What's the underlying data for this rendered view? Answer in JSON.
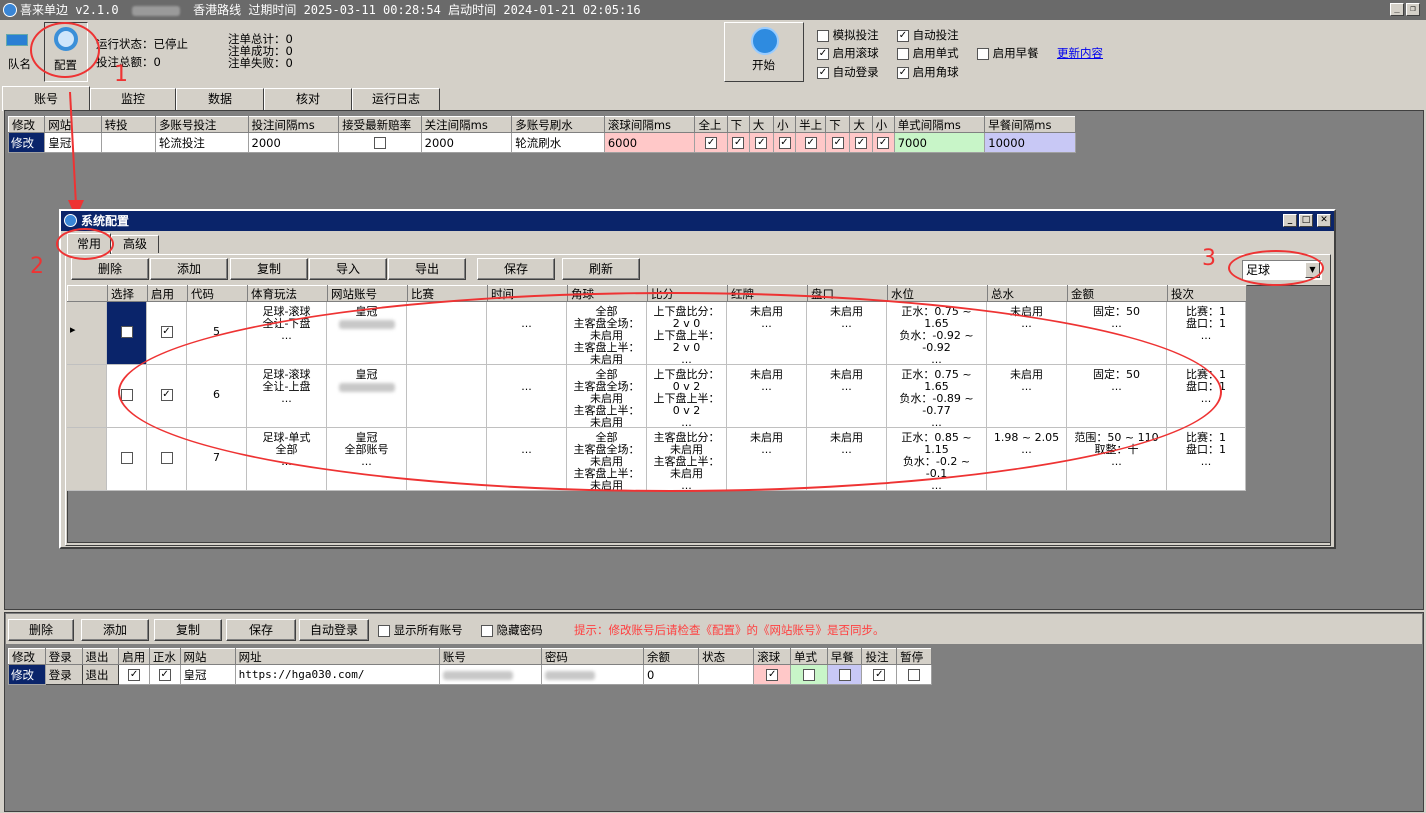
{
  "window": {
    "title_app": "喜来单边",
    "title_version": "v2.1.0",
    "title_route": "香港路线",
    "expire_label": "过期时间",
    "expire_value": "2025-03-11 00:28:54",
    "start_label": "启动时间",
    "start_value": "2024-01-21 02:05:16"
  },
  "toolbar": {
    "queue_label": "队名",
    "config_label": "配置",
    "status_label": "运行状态：已停止",
    "bet_total_label": "投注总额：0",
    "orders_total": "注单总计：0",
    "orders_success": "注单成功：0",
    "orders_fail": "注单失败：0",
    "start_label": "开始",
    "options": [
      {
        "label": "模拟投注",
        "checked": false
      },
      {
        "label": "自动投注",
        "checked": true
      },
      {
        "label": "启用滚球",
        "checked": true
      },
      {
        "label": "启用单式",
        "checked": false
      },
      {
        "label": "启用早餐",
        "checked": false
      },
      {
        "label": "自动登录",
        "checked": true
      },
      {
        "label": "启用角球",
        "checked": true
      }
    ],
    "update_link": "更新内容"
  },
  "main_tabs": [
    "账号",
    "监控",
    "数据",
    "核对",
    "运行日志"
  ],
  "account_grid": {
    "headers": [
      "修改",
      "网站",
      "转投",
      "多账号投注",
      "投注间隔ms",
      "接受最新赔率",
      "关注间隔ms",
      "多账号刷水",
      "滚球间隔ms",
      "全上",
      "下",
      "大",
      "小",
      "半上",
      "下",
      "大",
      "小",
      "单式间隔ms",
      "早餐间隔ms"
    ],
    "row": {
      "edit": "修改",
      "site": "皇冠",
      "transfer": "",
      "multi_bet": "轮流投注",
      "bet_interval": "2000",
      "watch_interval": "2000",
      "refresh": "轮流刷水",
      "live_interval": "6000",
      "single_interval": "7000",
      "early_interval": "10000"
    }
  },
  "annotations": {
    "n1": "1",
    "n2": "2",
    "n3": "3"
  },
  "dialog": {
    "title": "系统配置",
    "tabs": [
      "常用",
      "高级"
    ],
    "buttons": [
      "删除",
      "添加",
      "复制",
      "导入",
      "导出",
      "保存",
      "刷新"
    ],
    "sport_select": "足球",
    "headers": [
      "选择",
      "启用",
      "代码",
      "体育玩法",
      "网站账号",
      "比赛",
      "时间",
      "角球",
      "比分",
      "红牌",
      "盘口",
      "水位",
      "总水",
      "金额",
      "投次"
    ],
    "rows": [
      {
        "code": "5",
        "enabled": true,
        "selected": false,
        "play": [
          "足球-滚球",
          "全让-下盘",
          "..."
        ],
        "account": [
          "皇冠"
        ],
        "match": "",
        "time": "...",
        "corner": [
          "全部",
          "主客盘全场：",
          "未启用",
          "主客盘上半：",
          "未启用"
        ],
        "score": [
          "上下盘比分：",
          "2 v 0",
          "上下盘上半：",
          "2 v 0",
          "..."
        ],
        "red": [
          "未启用",
          "..."
        ],
        "handicap": [
          "未启用",
          "..."
        ],
        "water": [
          "正水：0.75 ~",
          "1.65",
          "负水：-0.92 ~",
          "-0.92",
          "..."
        ],
        "total": [
          "未启用",
          "..."
        ],
        "amount": [
          "固定：50",
          "..."
        ],
        "times": [
          "比赛：1",
          "盘口：1",
          "..."
        ]
      },
      {
        "code": "6",
        "enabled": true,
        "selected": false,
        "play": [
          "足球-滚球",
          "全让-上盘",
          "..."
        ],
        "account": [
          "皇冠"
        ],
        "match": "",
        "time": "...",
        "corner": [
          "全部",
          "主客盘全场：",
          "未启用",
          "主客盘上半：",
          "未启用"
        ],
        "score": [
          "上下盘比分：",
          "0 v 2",
          "上下盘上半：",
          "0 v 2",
          "..."
        ],
        "red": [
          "未启用",
          "..."
        ],
        "handicap": [
          "未启用",
          "..."
        ],
        "water": [
          "正水：0.75 ~",
          "1.65",
          "负水：-0.89 ~",
          "-0.77",
          "..."
        ],
        "total": [
          "未启用",
          "..."
        ],
        "amount": [
          "固定：50",
          "..."
        ],
        "times": [
          "比赛：1",
          "盘口：1",
          "..."
        ]
      },
      {
        "code": "7",
        "enabled": false,
        "selected": false,
        "play": [
          "足球-单式",
          "全部",
          "..."
        ],
        "account": [
          "皇冠",
          "全部账号",
          "..."
        ],
        "match": "",
        "time": "...",
        "corner": [
          "全部",
          "主客盘全场：",
          "未启用",
          "主客盘上半：",
          "未启用"
        ],
        "score": [
          "主客盘比分：",
          "未启用",
          "主客盘上半：",
          "未启用",
          "..."
        ],
        "red": [
          "未启用",
          "..."
        ],
        "handicap": [
          "未启用",
          "..."
        ],
        "water": [
          "正水：0.85 ~",
          "1.15",
          "负水：-0.2 ~",
          "-0.1",
          "..."
        ],
        "total": [
          "1.98 ~ 2.05",
          "..."
        ],
        "amount": [
          "范围：50 ~ 110",
          "取整：十",
          "..."
        ],
        "times": [
          "比赛：1",
          "盘口：1",
          "..."
        ]
      }
    ]
  },
  "bottom": {
    "buttons": [
      "删除",
      "添加",
      "复制",
      "保存",
      "自动登录"
    ],
    "show_all": "显示所有账号",
    "hide_pwd": "隐藏密码",
    "hint": "提示：修改账号后请检查《配置》的《网站账号》是否同步。",
    "headers": [
      "修改",
      "登录",
      "退出",
      "启用",
      "正水",
      "网站",
      "网址",
      "账号",
      "密码",
      "余额",
      "状态",
      "滚球",
      "单式",
      "早餐",
      "投注",
      "暂停"
    ],
    "row": {
      "edit": "修改",
      "login": "登录",
      "logout": "退出",
      "site": "皇冠",
      "url": "https://hga030.com/",
      "balance": "0",
      "status": ""
    }
  }
}
